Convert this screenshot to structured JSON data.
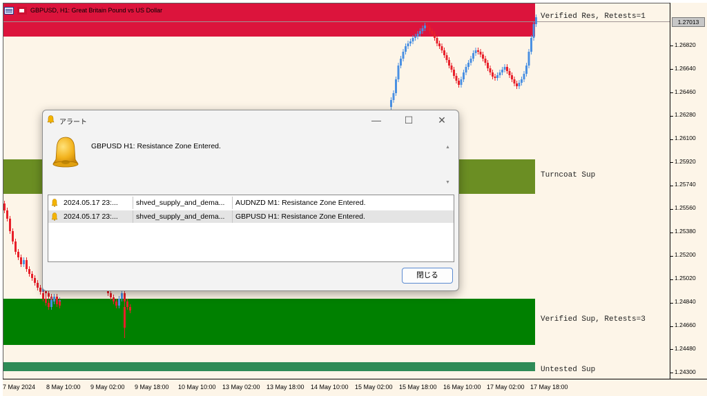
{
  "chart": {
    "title": "GBPUSD, H1:  Great Britain Pound vs US Dollar",
    "current_price": "1.27013",
    "bull_color": "#4a90e2",
    "bear_color": "#e8202a",
    "background": "#fdf5e8"
  },
  "price_axis": [
    "1.26820",
    "1.26640",
    "1.26460",
    "1.26280",
    "1.26100",
    "1.25920",
    "1.25740",
    "1.25560",
    "1.25380",
    "1.25200",
    "1.25020",
    "1.24840",
    "1.24660",
    "1.24480",
    "1.24300"
  ],
  "time_axis": [
    "7 May 2024",
    "8 May 10:00",
    "9 May 02:00",
    "9 May 18:00",
    "10 May 10:00",
    "13 May 02:00",
    "13 May 18:00",
    "14 May 10:00",
    "15 May 02:00",
    "15 May 18:00",
    "16 May 10:00",
    "17 May 02:00",
    "17 May 18:00"
  ],
  "zones": [
    {
      "label": "Verified Res, Retests=1",
      "color": "#dc143c"
    },
    {
      "label": "Turncoat Sup",
      "color": "#6b8e23"
    },
    {
      "label": "Verified Sup, Retests=3",
      "color": "#008000"
    },
    {
      "label": "Untested Sup",
      "color": "#2e8b57"
    }
  ],
  "dialog": {
    "title": "アラート",
    "message": "GBPUSD H1: Resistance Zone Entered.",
    "rows": [
      {
        "time": "2024.05.17 23:...",
        "source": "shved_supply_and_dema...",
        "message": "AUDNZD M1: Resistance Zone Entered."
      },
      {
        "time": "2024.05.17 23:...",
        "source": "shved_supply_and_dema...",
        "message": "GBPUSD H1: Resistance Zone Entered."
      }
    ],
    "close_label": "閉じる",
    "min_glyph": "—",
    "max_glyph": "☐",
    "close_glyph": "✕",
    "scroll_up_glyph": "▲",
    "scroll_down_glyph": "▼"
  }
}
